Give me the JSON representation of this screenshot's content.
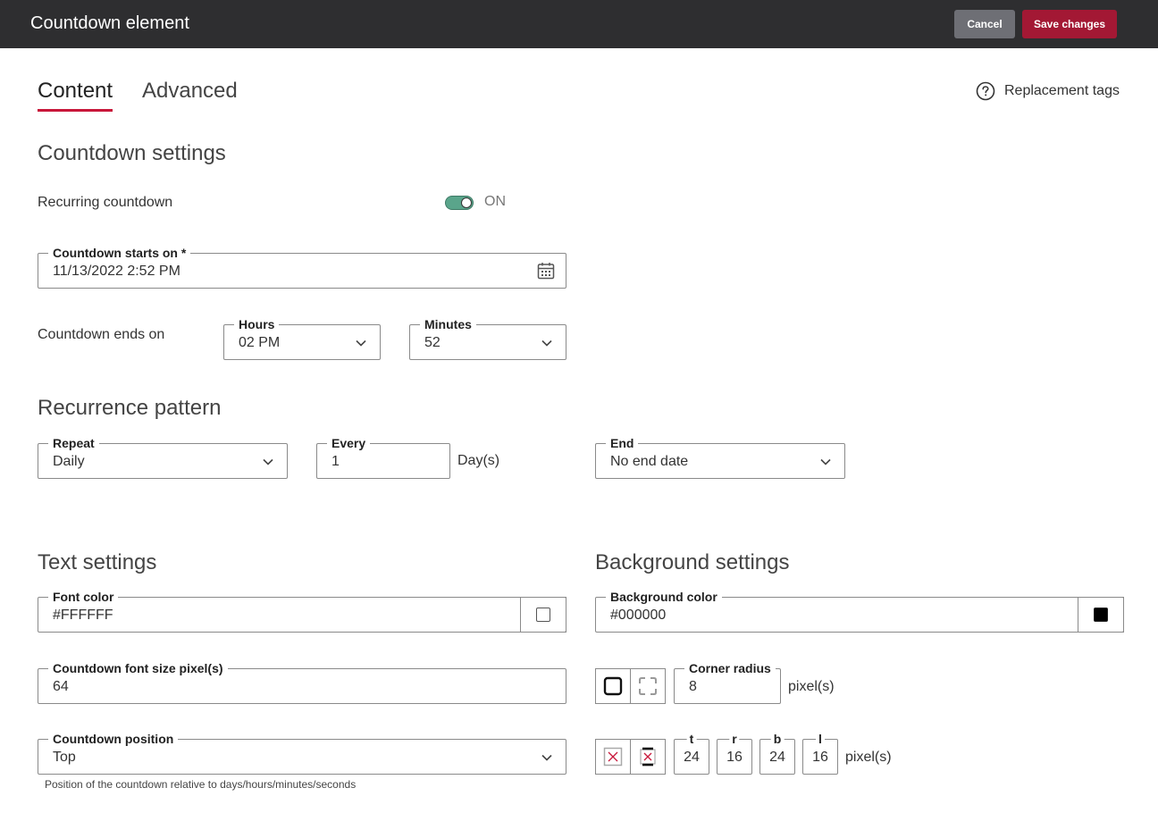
{
  "header": {
    "title": "Countdown element",
    "cancel_label": "Cancel",
    "save_label": "Save changes",
    "save_color": "#a31834"
  },
  "tabs": [
    {
      "label": "Content",
      "active": true
    },
    {
      "label": "Advanced",
      "active": false
    }
  ],
  "replacement_tags_label": "Replacement tags",
  "countdown_settings": {
    "heading": "Countdown settings",
    "recurring_label": "Recurring countdown",
    "recurring_state": "ON",
    "starts_label": "Countdown starts on *",
    "starts_value": "11/13/2022 2:52 PM",
    "ends_label": "Countdown ends on",
    "hours_label": "Hours",
    "hours_value": "02 PM",
    "minutes_label": "Minutes",
    "minutes_value": "52",
    "toggle_color": "#5aa58b"
  },
  "recurrence": {
    "heading": "Recurrence pattern",
    "repeat_label": "Repeat",
    "repeat_value": "Daily",
    "every_label": "Every",
    "every_value": "1",
    "every_unit": "Day(s)",
    "end_label": "End",
    "end_value": "No end date"
  },
  "text_settings": {
    "heading": "Text settings",
    "font_color_label": "Font color",
    "font_color_value": "#FFFFFF",
    "font_size_label": "Countdown font size pixel(s)",
    "font_size_value": "64",
    "position_label": "Countdown position",
    "position_value": "Top",
    "position_helper": "Position of the countdown relative to days/hours/minutes/seconds"
  },
  "background_settings": {
    "heading": "Background settings",
    "bg_color_label": "Background color",
    "bg_color_value": "#000000",
    "corner_radius_label": "Corner radius",
    "corner_radius_value": "8",
    "corner_unit": "pixel(s)",
    "padding": [
      {
        "label": "t",
        "value": "24"
      },
      {
        "label": "r",
        "value": "16"
      },
      {
        "label": "b",
        "value": "24"
      },
      {
        "label": "l",
        "value": "16"
      }
    ],
    "padding_unit": "pixel(s)"
  }
}
